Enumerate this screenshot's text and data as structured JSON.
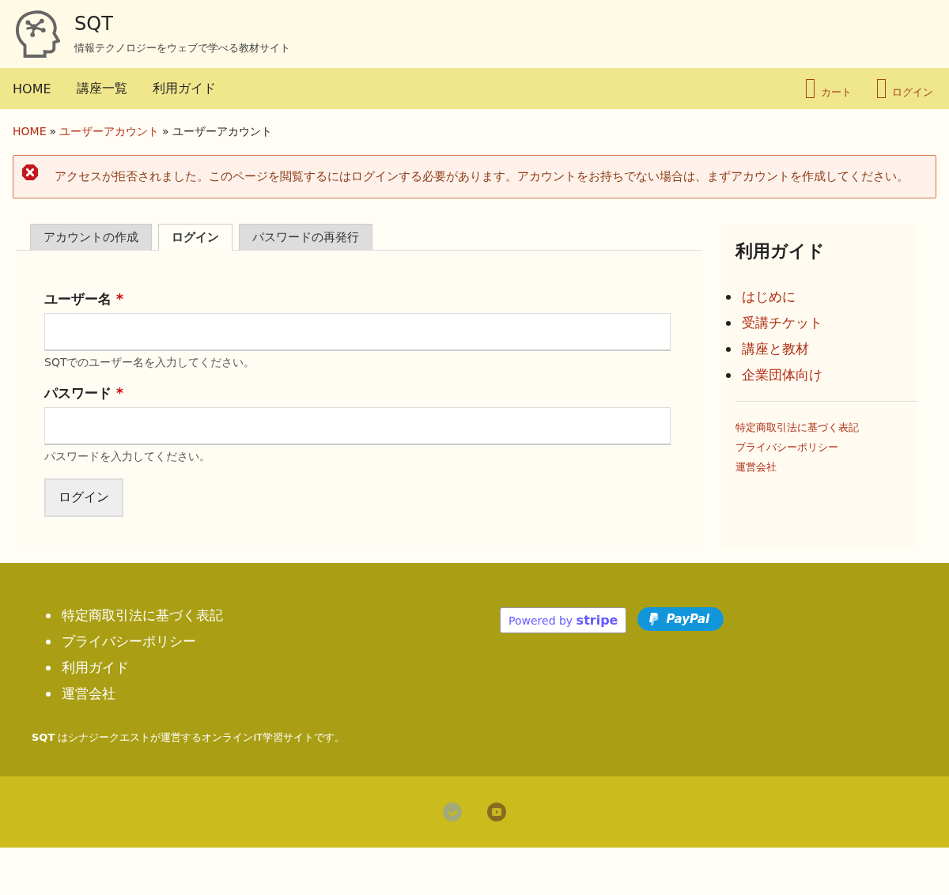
{
  "site": {
    "name": "SQT",
    "tagline": "情報テクノロジーをウェブで学べる教材サイト"
  },
  "nav": {
    "items": [
      "HOME",
      "講座一覧",
      "利用ガイド"
    ],
    "cart": "カート",
    "login": "ログイン"
  },
  "breadcrumb": {
    "links": [
      "HOME",
      "ユーザーアカウント"
    ],
    "separator": "»",
    "current": "ユーザーアカウント"
  },
  "error": {
    "message": "アクセスが拒否されました。このページを閲覧するにはログインする必要があります。アカウントをお持ちでない場合は、まずアカウントを作成してください。"
  },
  "tabs": [
    {
      "label": "アカウントの作成",
      "selected": false
    },
    {
      "label": "ログイン",
      "selected": true
    },
    {
      "label": "パスワードの再発行",
      "selected": false
    }
  ],
  "form": {
    "fields": [
      {
        "label": "ユーザー名",
        "required_mark": "*",
        "help": "SQTでのユーザー名を入力してください。"
      },
      {
        "label": "パスワード",
        "required_mark": "*",
        "help": "パスワードを入力してください。"
      }
    ],
    "submit": "ログイン"
  },
  "sidebar": {
    "title": "利用ガイド",
    "items": [
      "はじめに",
      "受講チケット",
      "講座と教材",
      "企業団体向け"
    ],
    "links": [
      "特定商取引法に基づく表記",
      "プライバシーポリシー",
      "運営会社"
    ]
  },
  "footer": {
    "links": [
      "特定商取引法に基づく表記",
      "プライバシーポリシー",
      "利用ガイド",
      "運営会社"
    ],
    "note": "**SQT** はシナジークエストが運営するオンラインIT学習サイトです。",
    "stripe": {
      "prefix": "Powered by",
      "brand": "stripe"
    },
    "paypal": "PayPal"
  }
}
